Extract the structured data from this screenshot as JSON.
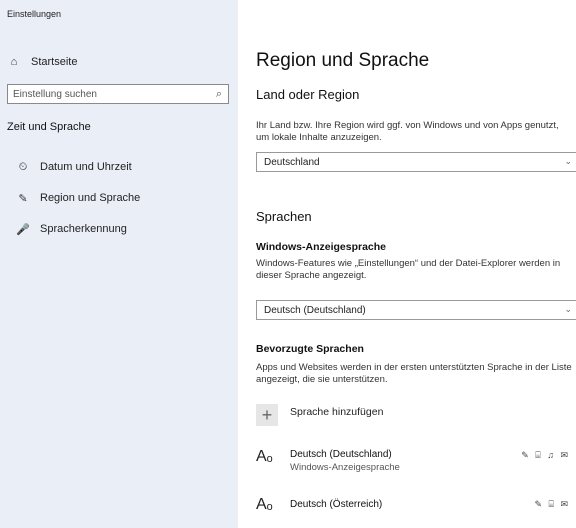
{
  "sidebar": {
    "app_title": "Einstellungen",
    "home_icon": "home-icon",
    "home_label": "Startseite",
    "search_placeholder": "Einstellung suchen",
    "search_icon": "search-icon",
    "section_label": "Zeit und Sprache",
    "items": [
      {
        "icon": "clock-calendar-icon",
        "glyph": "⏲",
        "label": "Datum und Uhrzeit"
      },
      {
        "icon": "region-language-icon",
        "glyph": "✎",
        "label": "Region und Sprache"
      },
      {
        "icon": "microphone-icon",
        "glyph": "🎤",
        "label": "Spracherkennung"
      }
    ]
  },
  "main": {
    "title": "Region und Sprache",
    "region": {
      "heading": "Land oder Region",
      "description": "Ihr Land bzw. Ihre Region wird ggf. von Windows und von Apps genutzt, um lokale Inhalte anzuzeigen.",
      "value": "Deutschland"
    },
    "languages": {
      "heading": "Sprachen",
      "display_heading": "Windows-Anzeigesprache",
      "display_description": "Windows-Features wie „Einstellungen“ und der Datei-Explorer werden in dieser Sprache angezeigt.",
      "display_value": "Deutsch (Deutschland)",
      "preferred_heading": "Bevorzugte Sprachen",
      "preferred_description": "Apps und Websites werden in der ersten unterstützten Sprache in der Liste angezeigt, die sie unterstützen.",
      "add_label": "Sprache hinzufügen",
      "add_icon": "plus-icon",
      "list": [
        {
          "name": "Deutsch (Deutschland)",
          "sub": "Windows-Anzeigesprache",
          "caps": "✎ ⌸ ♫ ✉"
        },
        {
          "name": "Deutsch (Österreich)",
          "sub": "",
          "caps": "✎ ⌸ ✉"
        }
      ]
    }
  }
}
